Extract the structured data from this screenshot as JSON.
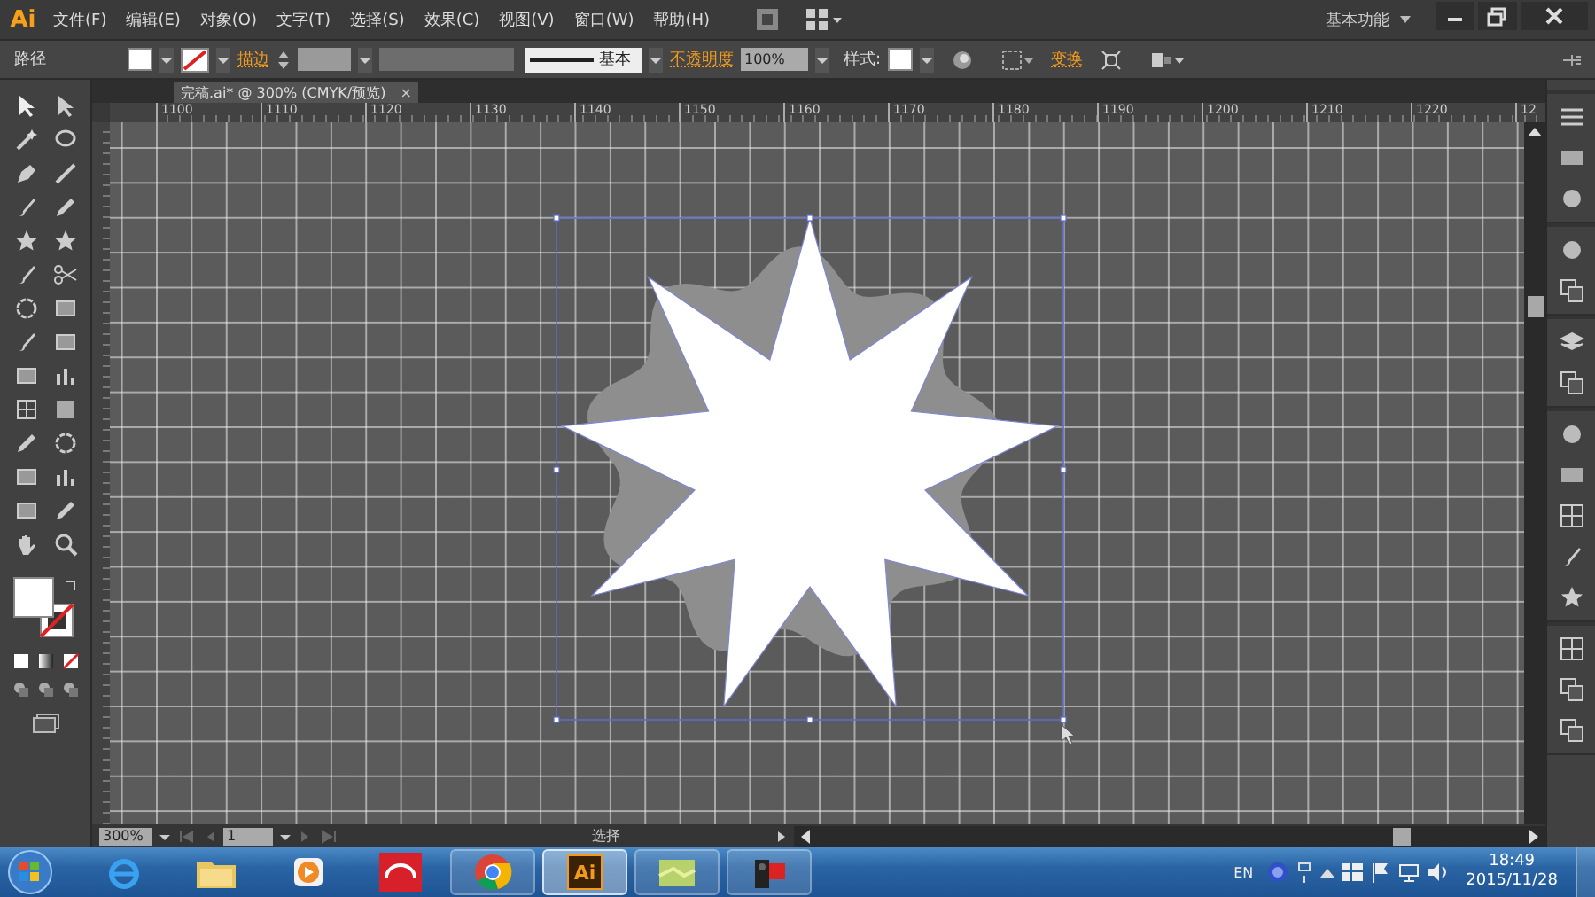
{
  "app": {
    "logo": "Ai",
    "menus": [
      "文件(F)",
      "编辑(E)",
      "对象(O)",
      "文字(T)",
      "选择(S)",
      "效果(C)",
      "视图(V)",
      "窗口(W)",
      "帮助(H)"
    ],
    "workspace": "基本功能"
  },
  "control_bar": {
    "object_type": "路径",
    "stroke_label": "描边",
    "stroke_style": "基本",
    "opacity_label": "不透明度",
    "opacity": "100%",
    "style_label": "样式:",
    "transform_label": "变换"
  },
  "document_tab": {
    "title": "完稿.ai* @ 300% (CMYK/预览)",
    "close": "×"
  },
  "ruler": {
    "marks": [
      "1100",
      "1110",
      "1120",
      "1130",
      "1140",
      "1150",
      "1160",
      "1170",
      "1180",
      "1190",
      "1200",
      "1210",
      "1220",
      "12"
    ]
  },
  "status_bar": {
    "zoom": "300%",
    "artboard": "1",
    "tool": "选择"
  },
  "taskbar": {
    "apps": [
      {
        "kind": "browser-e",
        "running": false,
        "selected": false
      },
      {
        "kind": "folder",
        "running": false,
        "selected": false
      },
      {
        "kind": "player",
        "running": false,
        "selected": false
      },
      {
        "kind": "red-app",
        "running": false,
        "selected": false
      },
      {
        "kind": "chrome",
        "running": true,
        "selected": false
      },
      {
        "kind": "illustrator",
        "label": "Ai",
        "running": true,
        "selected": true
      },
      {
        "kind": "green-app",
        "running": true,
        "selected": false
      },
      {
        "kind": "recorder",
        "running": true,
        "selected": false
      }
    ],
    "language": "EN",
    "time": "18:49",
    "date": "2015/11/28"
  }
}
